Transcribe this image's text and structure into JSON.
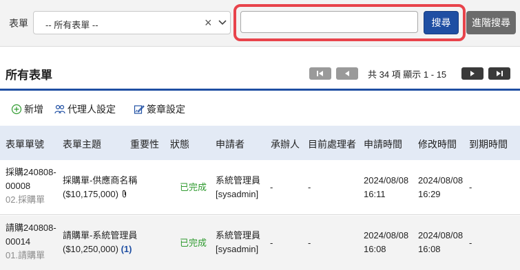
{
  "filter": {
    "form_label": "表單",
    "form_select_value": "-- 所有表單 --",
    "clear_icon": "×",
    "search_value": "",
    "search_placeholder": "",
    "search_button": "搜尋",
    "advanced_search_button": "進階搜尋"
  },
  "section": {
    "title": "所有表單",
    "page_info": "共 34 項 顯示 1 - 15"
  },
  "toolbar": {
    "add_label": "新增",
    "delegate_label": "代理人設定",
    "signature_label": "簽章設定"
  },
  "table": {
    "headers": [
      "表單單號",
      "表單主題",
      "重要性",
      "狀態",
      "申請者",
      "承辦人",
      "目前處理者",
      "申請時間",
      "修改時間",
      "到期時間"
    ],
    "rows": [
      {
        "form_no_1": "採購240808-",
        "form_no_2": "00008",
        "form_type": "02.採購單",
        "subject_1": "採購單-供應商名稱",
        "subject_2": "($10,175,000)",
        "status": "已完成",
        "applicant_1": "系統管理員",
        "applicant_2": "[sysadmin]",
        "handler": "-",
        "current_processor": "-",
        "apply_date": "2024/08/08",
        "apply_time": "16:11",
        "modify_date": "2024/08/08",
        "modify_time": "16:29",
        "due": "-"
      },
      {
        "form_no_1": "請購240808-",
        "form_no_2": "00014",
        "form_type": "01.請購單",
        "subject_1": "請購單-系統管理員",
        "subject_2": "($10,250,000)",
        "subject_count": "(1)",
        "status": "已完成",
        "applicant_1": "系統管理員",
        "applicant_2": "[sysadmin]",
        "handler": "-",
        "current_processor": "-",
        "apply_date": "2024/08/08",
        "apply_time": "16:08",
        "modify_date": "2024/08/08",
        "modify_time": "16:08",
        "due": "-"
      }
    ]
  },
  "colors": {
    "accent": "#1f4fa3",
    "highlight_border": "#e8434b",
    "status_done": "#2e9a2e",
    "header_bg": "#e3eaf5"
  }
}
